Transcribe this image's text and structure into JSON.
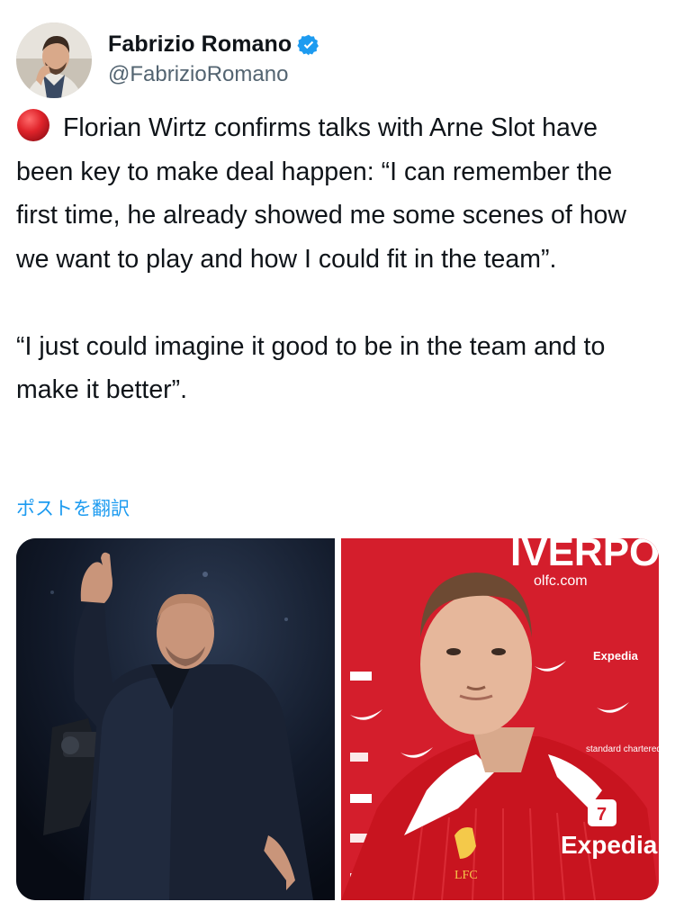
{
  "tweet": {
    "author": {
      "display_name": "Fabrizio Romano",
      "handle": "@FabrizioRomano",
      "verified": true,
      "avatar_icon": "profile-photo"
    },
    "emoji_icon": "red-circle-icon",
    "paragraphs": [
      "Florian Wirtz confirms talks with Arne Slot have been key to make deal happen: “I can remember the first time, he already showed me some scenes of how we want to play and how I could fit in the team”.",
      "“I just could imagine it good to be in the team and to make it better”."
    ],
    "translate_label": "ポストを翻訳",
    "media": {
      "left_photo": {
        "alt_icon": "man-thumbs-up-photo"
      },
      "right_photo": {
        "alt_icon": "player-in-red-kit-photo",
        "backdrop_text_top": "IVERPO",
        "backdrop_url": "olfc.com",
        "backdrop_sponsor": "Expedia",
        "backdrop_standard_chartered": "standard chartered",
        "shirt_sponsor": "Expedia",
        "crest_text": "LFC"
      }
    },
    "colors": {
      "verified_blue": "#1d9bf0",
      "link_blue": "#1d9bf0",
      "liverpool_red": "#d41e2c",
      "handle_grey": "#536471"
    }
  }
}
